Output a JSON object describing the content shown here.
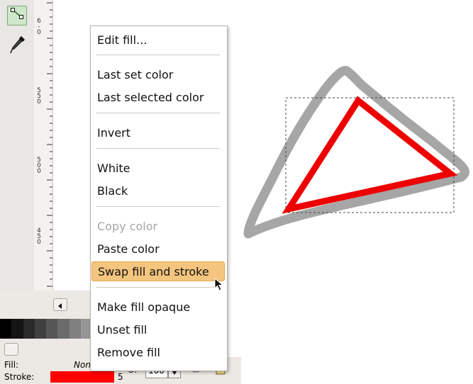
{
  "toolbox": {
    "tools": [
      {
        "icon": "node-editor-icon"
      },
      {
        "icon": "dropper-icon"
      }
    ]
  },
  "ruler": {
    "labels": [
      {
        "chars": [
          "6",
          "-",
          "0"
        ]
      },
      {
        "chars": [
          "5",
          "5",
          "0"
        ]
      },
      {
        "chars": [
          "5",
          "0",
          "0"
        ]
      },
      {
        "chars": [
          "4",
          "5",
          "0"
        ]
      }
    ]
  },
  "palette": {
    "colors": [
      "#000000",
      "#141414",
      "#2a2a2a",
      "#404040",
      "#565656",
      "#6b6b6b",
      "#808080",
      "#959595"
    ]
  },
  "status": {
    "fill_label": "Fill:",
    "fill_value": "None",
    "stroke_label": "Stroke:",
    "stroke_color": "#ff0000",
    "stroke_width": "5",
    "opacity_label": "O:",
    "opacity_value": "100"
  },
  "context_menu": {
    "items": [
      {
        "label": "Edit fill...",
        "state": "normal"
      },
      {
        "label": "Last set color",
        "state": "normal"
      },
      {
        "label": "Last selected color",
        "state": "normal"
      },
      {
        "label": "Invert",
        "state": "normal"
      },
      {
        "label": "White",
        "state": "normal"
      },
      {
        "label": "Black",
        "state": "normal"
      },
      {
        "label": "Copy color",
        "state": "disabled"
      },
      {
        "label": "Paste color",
        "state": "normal"
      },
      {
        "label": "Swap fill and stroke",
        "state": "highlighted"
      },
      {
        "label": "Make fill opaque",
        "state": "normal"
      },
      {
        "label": "Unset fill",
        "state": "normal"
      },
      {
        "label": "Remove fill",
        "state": "normal"
      }
    ]
  },
  "canvas": {
    "outline_color": "#a6a6a6",
    "triangle_color": "#ee0000",
    "selection_box_color": "#444444"
  },
  "colors": {
    "menu_highlight": "#f4c57e",
    "panel_bg": "#e9e7e3"
  }
}
